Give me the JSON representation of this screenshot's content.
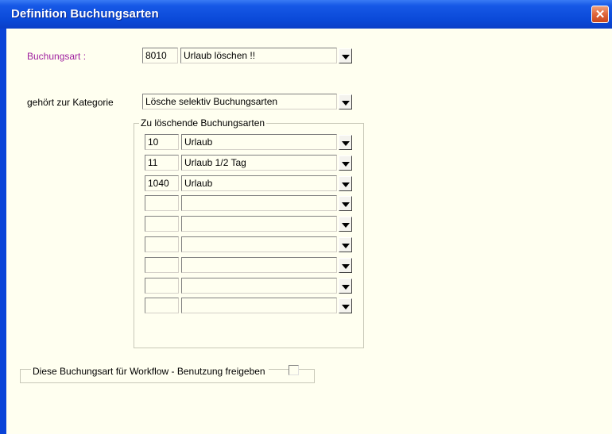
{
  "window": {
    "title": "Definition Buchungsarten",
    "close_symbol": "✕"
  },
  "buchungsart": {
    "label": "Buchungsart :",
    "code": "8010",
    "name": "Urlaub löschen !!"
  },
  "kategorie": {
    "label": "gehört zur Kategorie",
    "value": "Lösche selektiv Buchungsarten"
  },
  "delete_group": {
    "legend": "Zu löschende Buchungsarten",
    "rows": [
      {
        "code": "10",
        "name": "Urlaub"
      },
      {
        "code": "11",
        "name": "Urlaub 1/2 Tag"
      },
      {
        "code": "1040",
        "name": "Urlaub"
      },
      {
        "code": "",
        "name": ""
      },
      {
        "code": "",
        "name": ""
      },
      {
        "code": "",
        "name": ""
      },
      {
        "code": "",
        "name": ""
      },
      {
        "code": "",
        "name": ""
      },
      {
        "code": "",
        "name": ""
      }
    ]
  },
  "workflow": {
    "label": "Diese Buchungsart für Workflow - Benutzung freigeben",
    "checked": false
  }
}
